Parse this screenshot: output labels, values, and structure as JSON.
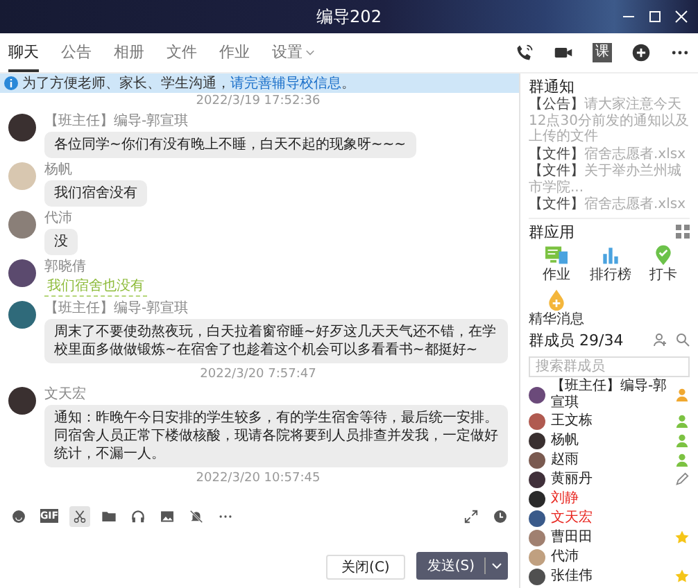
{
  "window": {
    "title": "编导202"
  },
  "tabs": [
    {
      "label": "聊天",
      "selected": true
    },
    {
      "label": "公告",
      "selected": false
    },
    {
      "label": "相册",
      "selected": false
    },
    {
      "label": "文件",
      "selected": false
    },
    {
      "label": "作业",
      "selected": false
    },
    {
      "label": "设置",
      "selected": false,
      "dropdown": true
    }
  ],
  "header_actions": [
    {
      "kind": "phone"
    },
    {
      "kind": "video"
    },
    {
      "kind": "class",
      "label": "课"
    },
    {
      "kind": "add"
    },
    {
      "kind": "more"
    }
  ],
  "banner": {
    "text": "为了方便老师、家长、学生沟通，",
    "link": "请完善辅导校信息",
    "end": "。"
  },
  "messages": [
    {
      "kind": "time",
      "text": "2022/3/19 17:52:36"
    },
    {
      "kind": "bubble",
      "sender": "【班主任】编导-郭宣琪",
      "text": "各位同学~你们有没有晚上不睡，白天不起的现象呀~~~"
    },
    {
      "kind": "bubble",
      "sender": "杨帆",
      "text": "我们宿舍没有"
    },
    {
      "kind": "bubble",
      "sender": "代沛",
      "text": "没"
    },
    {
      "kind": "sticker",
      "sender": "郭晓倩",
      "text": "我们宿舍也没有"
    },
    {
      "kind": "bubble",
      "sender": "【班主任】编导-郭宣琪",
      "text": "周末了不要使劲熬夜玩，白天拉着窗帘睡~好歹这几天天气还不错，在学校里面多做做锻炼~在宿舍了也趁着这个机会可以多看看书~都挺好~"
    },
    {
      "kind": "time",
      "text": "2022/3/20 7:57:47"
    },
    {
      "kind": "bubble",
      "sender": "文天宏",
      "text": "通知：昨晚午今日安排的学生较多，有的学生宿舍等待，最后统一安排。同宿舍人员正常下楼做核酸，现请各院将要到人员排查并发我，一定做好统计，不漏一人。"
    },
    {
      "kind": "time",
      "text": "2022/3/20 10:57:45"
    }
  ],
  "toolbar": {
    "left": [
      {
        "kind": "emoji",
        "selected": false
      },
      {
        "kind": "gif",
        "label": "GIF",
        "selected": false
      },
      {
        "kind": "scissors",
        "selected": true
      },
      {
        "kind": "folder",
        "selected": false
      },
      {
        "kind": "music",
        "selected": false
      },
      {
        "kind": "image",
        "selected": false
      },
      {
        "kind": "bell-off",
        "selected": false
      },
      {
        "kind": "more",
        "selected": false
      }
    ],
    "right": [
      {
        "kind": "expand",
        "selected": false
      },
      {
        "kind": "clock",
        "selected": false
      }
    ]
  },
  "buttons": {
    "close": "关闭(C)",
    "send": "发送(S)"
  },
  "side": {
    "notice_title": "群通知",
    "notices": [
      {
        "tag": "【公告】",
        "text": "请大家注意今天12点30分前发的通知以及上传的文件"
      },
      {
        "tag": "【文件】",
        "text": "宿舍志愿者.xlsx"
      },
      {
        "tag": "【文件】",
        "text": "关于举办兰州城市学院..."
      },
      {
        "tag": "【文件】",
        "text": "宿舍志愿者.xlsx"
      }
    ],
    "apps_title": "群应用",
    "apps": [
      {
        "kind": "homework",
        "label": "作业"
      },
      {
        "kind": "ranking",
        "label": "排行榜"
      },
      {
        "kind": "checkin",
        "label": "打卡"
      },
      {
        "kind": "essence",
        "label": "精华消息"
      }
    ],
    "members_title": "群成员 29/34",
    "search": {
      "placeholder": "搜索群成员"
    },
    "members": [
      {
        "name": "【班主任】编导-郭宣琪",
        "kind": "owner",
        "color": "#222222"
      },
      {
        "name": "王文栋",
        "kind": "admin",
        "color": "#222222"
      },
      {
        "name": "杨帆",
        "kind": "admin",
        "color": "#222222"
      },
      {
        "name": "赵雨",
        "kind": "admin",
        "color": "#222222"
      },
      {
        "name": "黄丽丹",
        "kind": "editor",
        "color": "#222222"
      },
      {
        "name": "刘静",
        "kind": "none",
        "color": "#e8261f"
      },
      {
        "name": "文天宏",
        "kind": "none",
        "color": "#e8261f"
      },
      {
        "name": "曹田田",
        "kind": "star",
        "color": "#222222"
      },
      {
        "name": "代沛",
        "kind": "none",
        "color": "#222222"
      },
      {
        "name": "张佳伟",
        "kind": "star",
        "color": "#222222"
      }
    ]
  }
}
